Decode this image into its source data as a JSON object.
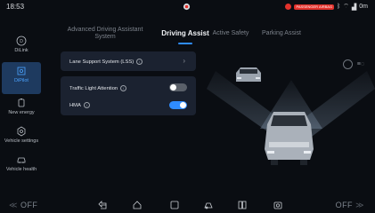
{
  "status": {
    "time": "18:53",
    "brand_badge": "PASSENGER AIRBAG",
    "right_text": "0m"
  },
  "sidebar": {
    "items": [
      {
        "label": "DiLink",
        "icon": "d-circle-icon",
        "active": false
      },
      {
        "label": "DiPilot",
        "icon": "steering-grid-icon",
        "active": true
      },
      {
        "label": "New energy",
        "icon": "battery-icon",
        "active": false
      },
      {
        "label": "Vehicle settings",
        "icon": "gear-icon",
        "active": false
      },
      {
        "label": "Vehicle health",
        "icon": "car-health-icon",
        "active": false
      }
    ]
  },
  "tabs": [
    {
      "label": "Advanced Driving Assistant System",
      "active": false
    },
    {
      "label": "Driving Assist",
      "active": true
    },
    {
      "label": "Active Safety",
      "active": false
    },
    {
      "label": "Parking Assist",
      "active": false
    }
  ],
  "settings": {
    "lss_label": "Lane Support System (LSS)",
    "traffic_light_label": "Traffic Light Attention",
    "traffic_light_on": false,
    "hma_label": "HMA",
    "hma_on": true
  },
  "bottom": {
    "left_label": "OFF",
    "right_label": "OFF"
  },
  "colors": {
    "accent": "#2f8cff",
    "panel": "#1b2230",
    "toggle_off": "#5a6069"
  }
}
